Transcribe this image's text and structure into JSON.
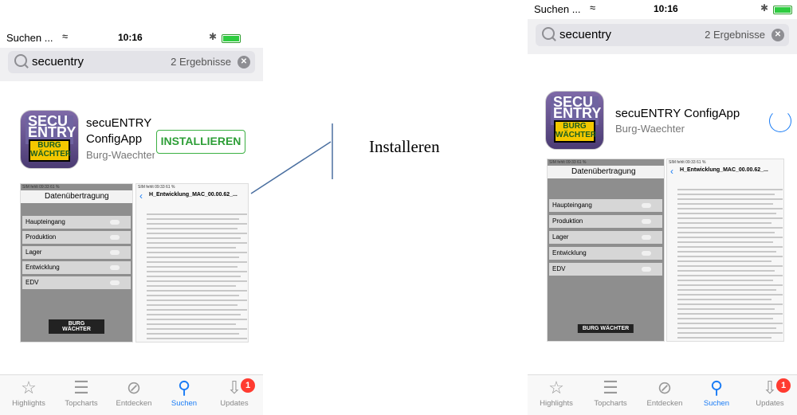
{
  "status": {
    "carrier": "Suchen ...",
    "time": "10:16"
  },
  "search": {
    "query": "secuentry",
    "result_count": "2 Ergebnisse"
  },
  "app": {
    "name_line1": "secuENTRY",
    "name_line2": "ConfigApp",
    "name_full": "secuENTRY ConfigApp",
    "developer": "Burg-Waechter",
    "developer_truncated": "Burg-Waechter",
    "install_label": "INSTALLIEREN",
    "icon_text_top": "SECU ENTRY",
    "icon_text_bottom": "BURG WÄCHTER"
  },
  "screenshot1": {
    "status": "SIM fehlt    09:33    61 %",
    "header": "Datenübertragung",
    "menu": [
      "Haupteingang",
      "Produktion",
      "Lager",
      "Entwicklung",
      "EDV"
    ],
    "logo": "BURG WÄCHTER"
  },
  "screenshot2": {
    "status": "SIM fehlt    09:33    61 %",
    "title": "H_Entwicklung_MAC_00.00.62_...",
    "title_short": "H_Entwicklung_MAC_00.00.62_..."
  },
  "tabs": [
    {
      "label": "Highlights",
      "icon": "star-icon"
    },
    {
      "label": "Topcharts",
      "icon": "list-icon"
    },
    {
      "label": "Entdecken",
      "icon": "compass-icon"
    },
    {
      "label": "Suchen",
      "icon": "search-icon"
    },
    {
      "label": "Updates",
      "icon": "download-icon",
      "badge": "1"
    }
  ],
  "annotation": "Installeren",
  "colors": {
    "accent": "#1a7cf5",
    "install_green": "#3cb043",
    "badge_red": "#ff3b30"
  }
}
